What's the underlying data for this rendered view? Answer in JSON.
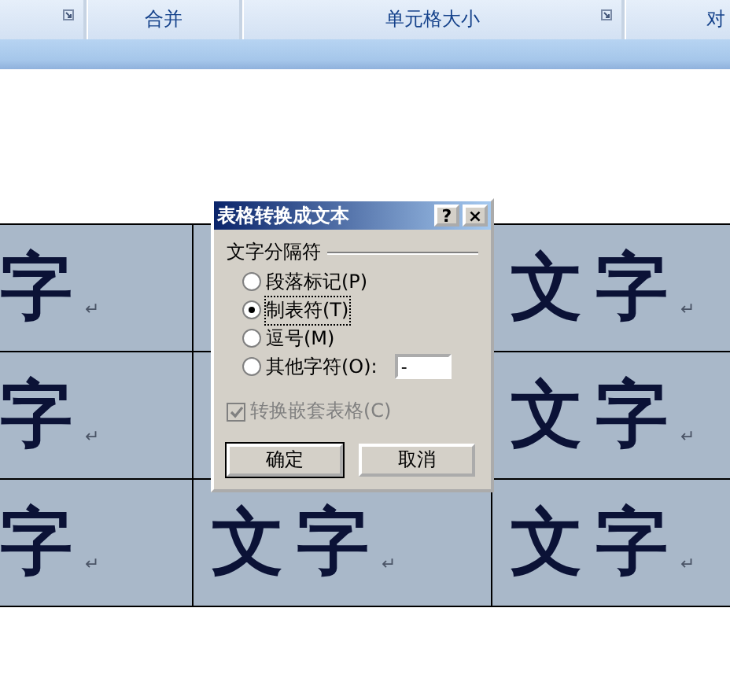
{
  "ribbon_groups": [
    {
      "launcher": true
    },
    {
      "label": "合并",
      "launcher": false
    },
    {
      "label": "单元格大小",
      "launcher": true
    },
    {
      "label": "对"
    }
  ],
  "table": {
    "rows": [
      [
        {
          "text": "字",
          "mark": "↵"
        },
        {},
        {
          "text": "文字",
          "mark": "↵"
        }
      ],
      [
        {
          "text": "字",
          "mark": "↵"
        },
        {},
        {
          "text": "文字",
          "mark": "↵"
        }
      ],
      [
        {
          "text": "字",
          "mark": "↵"
        },
        {
          "text": "文字",
          "mark": "↵"
        },
        {
          "text": "文字",
          "mark": "↵"
        }
      ]
    ]
  },
  "dialog": {
    "title": "表格转换成文本",
    "help": "?",
    "close": "×",
    "group_label": "文字分隔符",
    "options": [
      {
        "label": "段落标记(P)",
        "selected": false
      },
      {
        "label": "制表符(T)",
        "selected": true
      },
      {
        "label": "逗号(M)",
        "selected": false
      },
      {
        "label": "其他字符(O):",
        "selected": false,
        "value": "-"
      }
    ],
    "nested": {
      "label": "转换嵌套表格(C)",
      "checked": true,
      "disabled": true
    },
    "buttons": [
      {
        "label": "确定",
        "default": true
      },
      {
        "label": "取消",
        "default": false
      }
    ]
  }
}
